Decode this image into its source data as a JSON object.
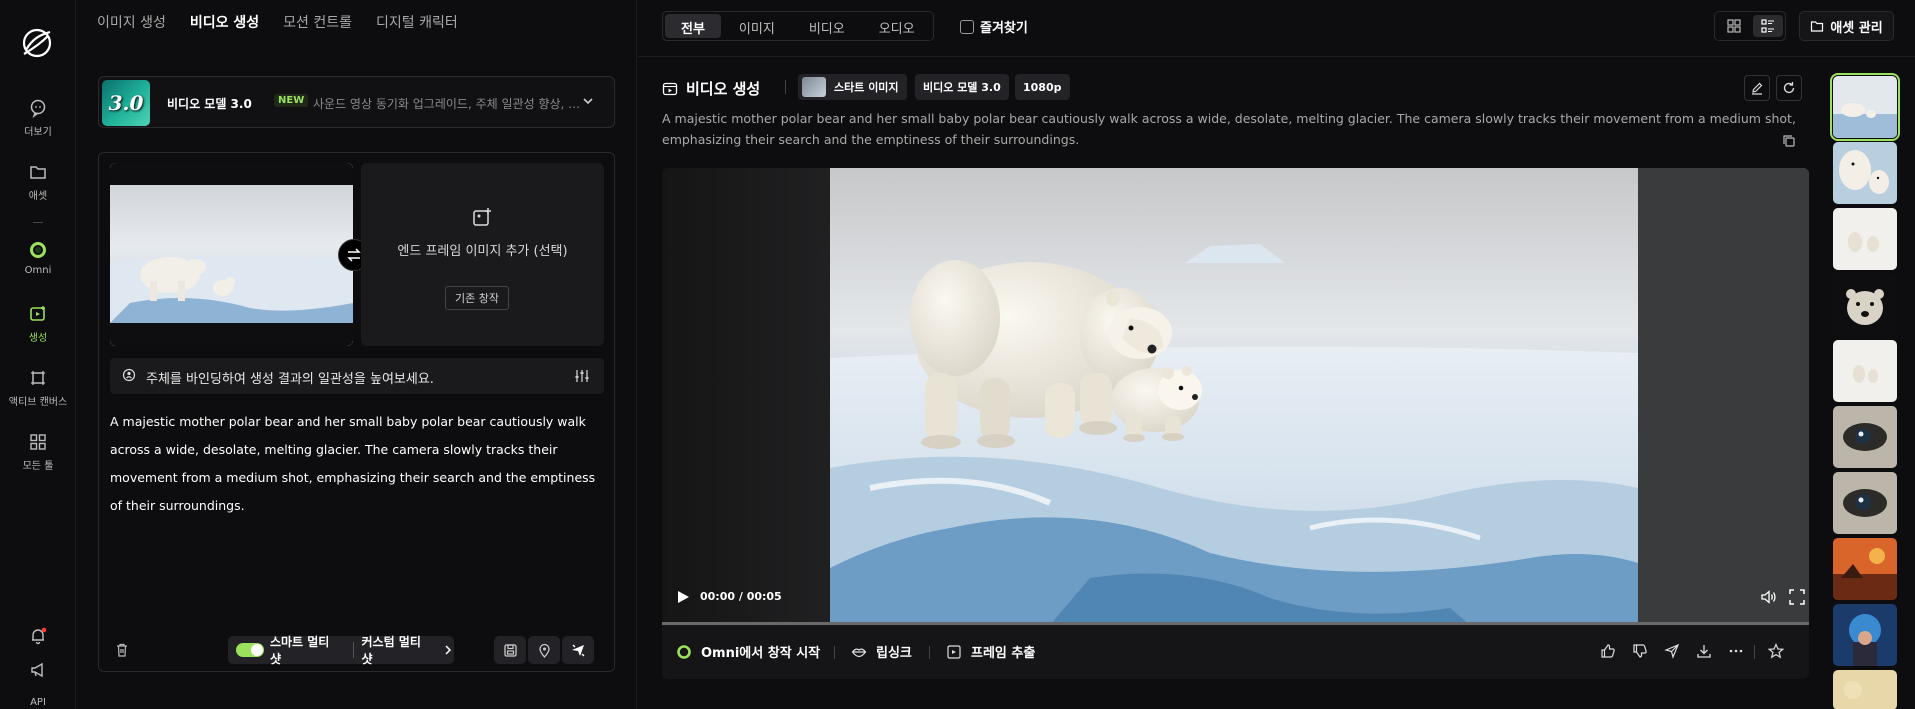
{
  "rail": {
    "items": [
      {
        "label": "더보기",
        "icon": "chat-bubble-icon"
      },
      {
        "label": "애셋",
        "icon": "folder-icon"
      },
      {
        "label": "Omni",
        "icon": "omni-ring-icon"
      },
      {
        "label": "생성",
        "icon": "create-icon"
      },
      {
        "label": "액티브 캔버스",
        "icon": "canvas-icon"
      },
      {
        "label": "모든 툴",
        "icon": "grid-icon"
      }
    ],
    "api_label": "API"
  },
  "left_panel": {
    "tabs": [
      "이미지 생성",
      "비디오 생성",
      "모션 컨트롤",
      "디지털 캐릭터"
    ],
    "active_tab": "비디오 생성",
    "model": {
      "thumb_text": "3.0",
      "name": "비디오 모델 3.0",
      "badge": "NEW",
      "description": "사운드 영상 동기화 업그레이드, 주체 일관성 향상, 멀..."
    },
    "end_frame": {
      "text": "엔드 프레임 이미지 추가 (선택)",
      "button": "기존 창작"
    },
    "bind_hint": "주체를 바인딩하여 생성 결과의 일관성을 높여보세요.",
    "prompt": "A majestic mother polar bear and her small baby polar bear cautiously walk across a wide, desolate, melting glacier. The camera slowly tracks their movement from a medium shot, emphasizing their search and the emptiness of their surroundings.",
    "smart_multishot": "스마트 멀티 샷",
    "custom_multishot": "커스텀 멀티 샷"
  },
  "main": {
    "filters": [
      "전부",
      "이미지",
      "비디오",
      "오디오"
    ],
    "active_filter": "전부",
    "favorites": "즐겨찾기",
    "asset_manage": "애셋 관리",
    "section_title": "비디오 생성",
    "chips": {
      "start": "스타트 이미지",
      "model": "비디오 모델 3.0",
      "res": "1080p"
    },
    "description": "A majestic mother polar bear and her small baby polar bear cautiously walk across a wide, desolate, melting glacier. The camera slowly tracks their movement from a medium shot, emphasizing their search and the emptiness of their surroundings.",
    "player": {
      "time": "00:00 / 00:05",
      "progress": 0
    },
    "actions": {
      "omni": "Omni에서 창작 시작",
      "lipsync": "립싱크",
      "frame": "프레임 추출"
    }
  },
  "colors": {
    "accent": "#9be15d",
    "bg": "#0d0d0f",
    "panel": "#1a1a1d"
  }
}
